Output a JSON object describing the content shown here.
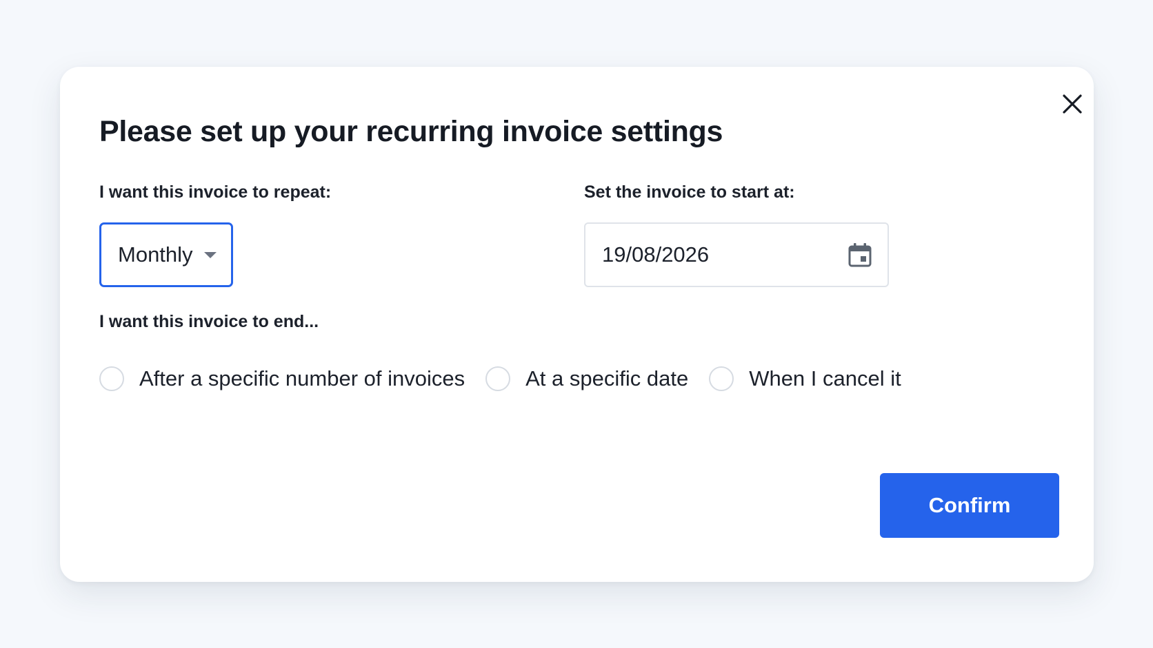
{
  "modal": {
    "title": "Please set up your recurring invoice settings",
    "close_icon": "close-icon"
  },
  "repeat": {
    "label": "I want this invoice to repeat:",
    "selected": "Monthly"
  },
  "start": {
    "label": "Set the invoice to start at:",
    "value": "19/08/2026",
    "icon": "calendar-icon"
  },
  "end": {
    "label": "I want this invoice to end...",
    "options": [
      {
        "label": "After a specific number of invoices",
        "checked": false
      },
      {
        "label": "At a specific date",
        "checked": false
      },
      {
        "label": "When I cancel it",
        "checked": false
      }
    ]
  },
  "actions": {
    "confirm_label": "Confirm"
  },
  "colors": {
    "accent": "#2563eb",
    "background": "#f5f8fc",
    "text": "#1a1f29",
    "border": "#dfe3e9"
  }
}
